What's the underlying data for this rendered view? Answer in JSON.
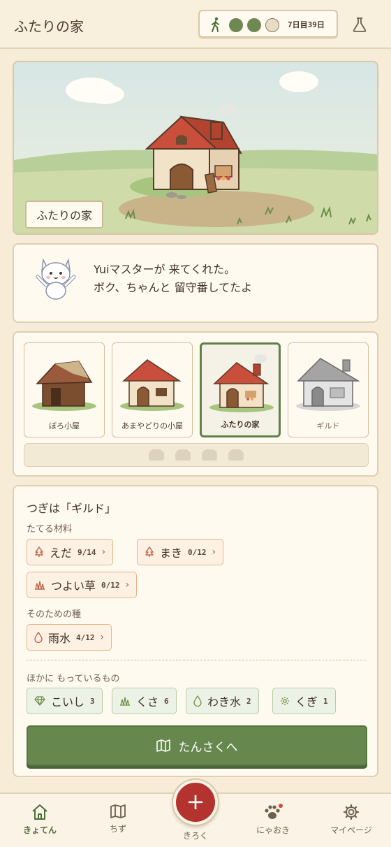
{
  "header": {
    "title": "ふたりの家",
    "status_days": "7日目39日",
    "status_dots": [
      "filled",
      "filled",
      "empty"
    ],
    "icons": {
      "walk": "walking-person-icon",
      "flask": "flask-icon"
    }
  },
  "scene": {
    "label": "ふたりの家"
  },
  "message": {
    "line1": "Yuiマスターが 来てくれた。",
    "line2": "ボク、ちゃんと 留守番してたよ"
  },
  "stages": [
    {
      "name": "ぼろ小屋",
      "selected": false
    },
    {
      "name": "あまやどりの小屋",
      "selected": false
    },
    {
      "name": "ふたりの家",
      "selected": true
    },
    {
      "name": "ギルド",
      "selected": false
    }
  ],
  "build": {
    "next_title": "つぎは「ギルド」",
    "materials_label": "たてる材料",
    "materials": [
      {
        "icon": "tree-icon",
        "name": "えだ",
        "count": "9/14"
      },
      {
        "icon": "tree-icon",
        "name": "まき",
        "count": "0/12"
      },
      {
        "icon": "grass-icon",
        "name": "つよい草",
        "count": "0/12"
      }
    ],
    "seeds_label": "そのための種",
    "seeds": [
      {
        "icon": "water-drop-icon",
        "name": "雨水",
        "count": "4/12"
      }
    ],
    "owned_label": "ほかに もっているもの",
    "owned": [
      {
        "icon": "gem-icon",
        "name": "こいし",
        "count": "3"
      },
      {
        "icon": "grass-icon",
        "name": "くさ",
        "count": "6"
      },
      {
        "icon": "water-drop-icon",
        "name": "わき水",
        "count": "2"
      },
      {
        "icon": "gear-icon",
        "name": "くぎ",
        "count": "1"
      }
    ],
    "explore_label": "たんさくへ"
  },
  "nav": {
    "items": [
      {
        "label": "きょてん",
        "icon": "home-icon",
        "active": true
      },
      {
        "label": "ちず",
        "icon": "map-icon"
      },
      {
        "label": "にゃおき",
        "icon": "paw-icon"
      },
      {
        "label": "マイページ",
        "icon": "gear-icon"
      }
    ],
    "center": {
      "label": "きろく",
      "symbol": "+"
    }
  },
  "colors": {
    "accent_green": "#66874d",
    "accent_red": "#b4332e",
    "bg": "#f6ecd8"
  }
}
